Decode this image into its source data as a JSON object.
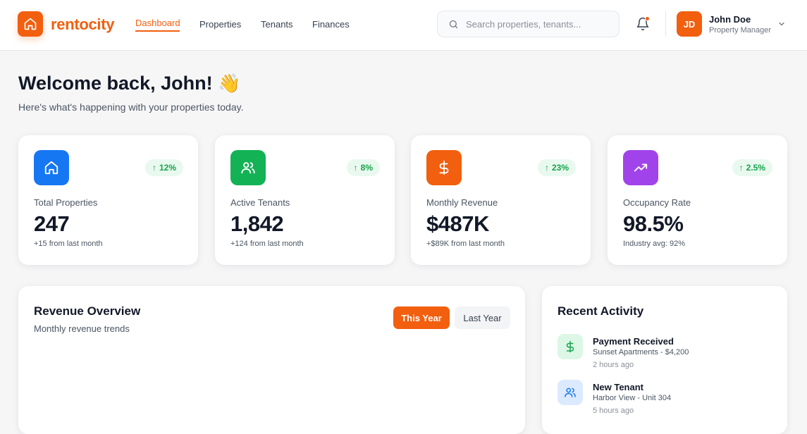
{
  "brand": {
    "name": "rentocity",
    "accent": "#f25f0f"
  },
  "nav": [
    {
      "label": "Dashboard",
      "active": true
    },
    {
      "label": "Properties",
      "active": false
    },
    {
      "label": "Tenants",
      "active": false
    },
    {
      "label": "Finances",
      "active": false
    }
  ],
  "search": {
    "placeholder": "Search properties, tenants...",
    "icon": "search-icon"
  },
  "notifications": {
    "icon": "bell-icon",
    "has_unread": true
  },
  "user": {
    "initials": "JD",
    "name": "John Doe",
    "role": "Property Manager"
  },
  "welcome": {
    "title": "Welcome back, John!",
    "emoji": "👋",
    "subtitle": "Here's what's happening with your properties today."
  },
  "stats": [
    {
      "icon": "home-icon",
      "color": "#1677f2",
      "label": "Total Properties",
      "value": "247",
      "change": "12%",
      "note": "+15 from last month"
    },
    {
      "icon": "users-icon",
      "color": "#12b255",
      "label": "Active Tenants",
      "value": "1,842",
      "change": "8%",
      "note": "+124 from last month"
    },
    {
      "icon": "dollar-icon",
      "color": "#f25f0f",
      "label": "Monthly Revenue",
      "value": "$487K",
      "change": "23%",
      "note": "+$89K from last month"
    },
    {
      "icon": "trending-up-icon",
      "color": "#a143ea",
      "label": "Occupancy Rate",
      "value": "98.5%",
      "change": "2.5%",
      "note": "Industry avg: 92%"
    }
  ],
  "revenue": {
    "title": "Revenue Overview",
    "subtitle": "Monthly revenue trends",
    "tabs": [
      {
        "label": "This Year",
        "active": true
      },
      {
        "label": "Last Year",
        "active": false
      }
    ]
  },
  "activity": {
    "title": "Recent Activity",
    "items": [
      {
        "icon": "dollar-icon",
        "icon_color": "#16a34a",
        "icon_bg": "#dcf7e6",
        "title": "Payment Received",
        "desc": "Sunset Apartments - $4,200",
        "time": "2 hours ago"
      },
      {
        "icon": "users-icon",
        "icon_color": "#1677f2",
        "icon_bg": "#dbeafe",
        "title": "New Tenant",
        "desc": "Harbor View - Unit 304",
        "time": "5 hours ago"
      }
    ]
  }
}
